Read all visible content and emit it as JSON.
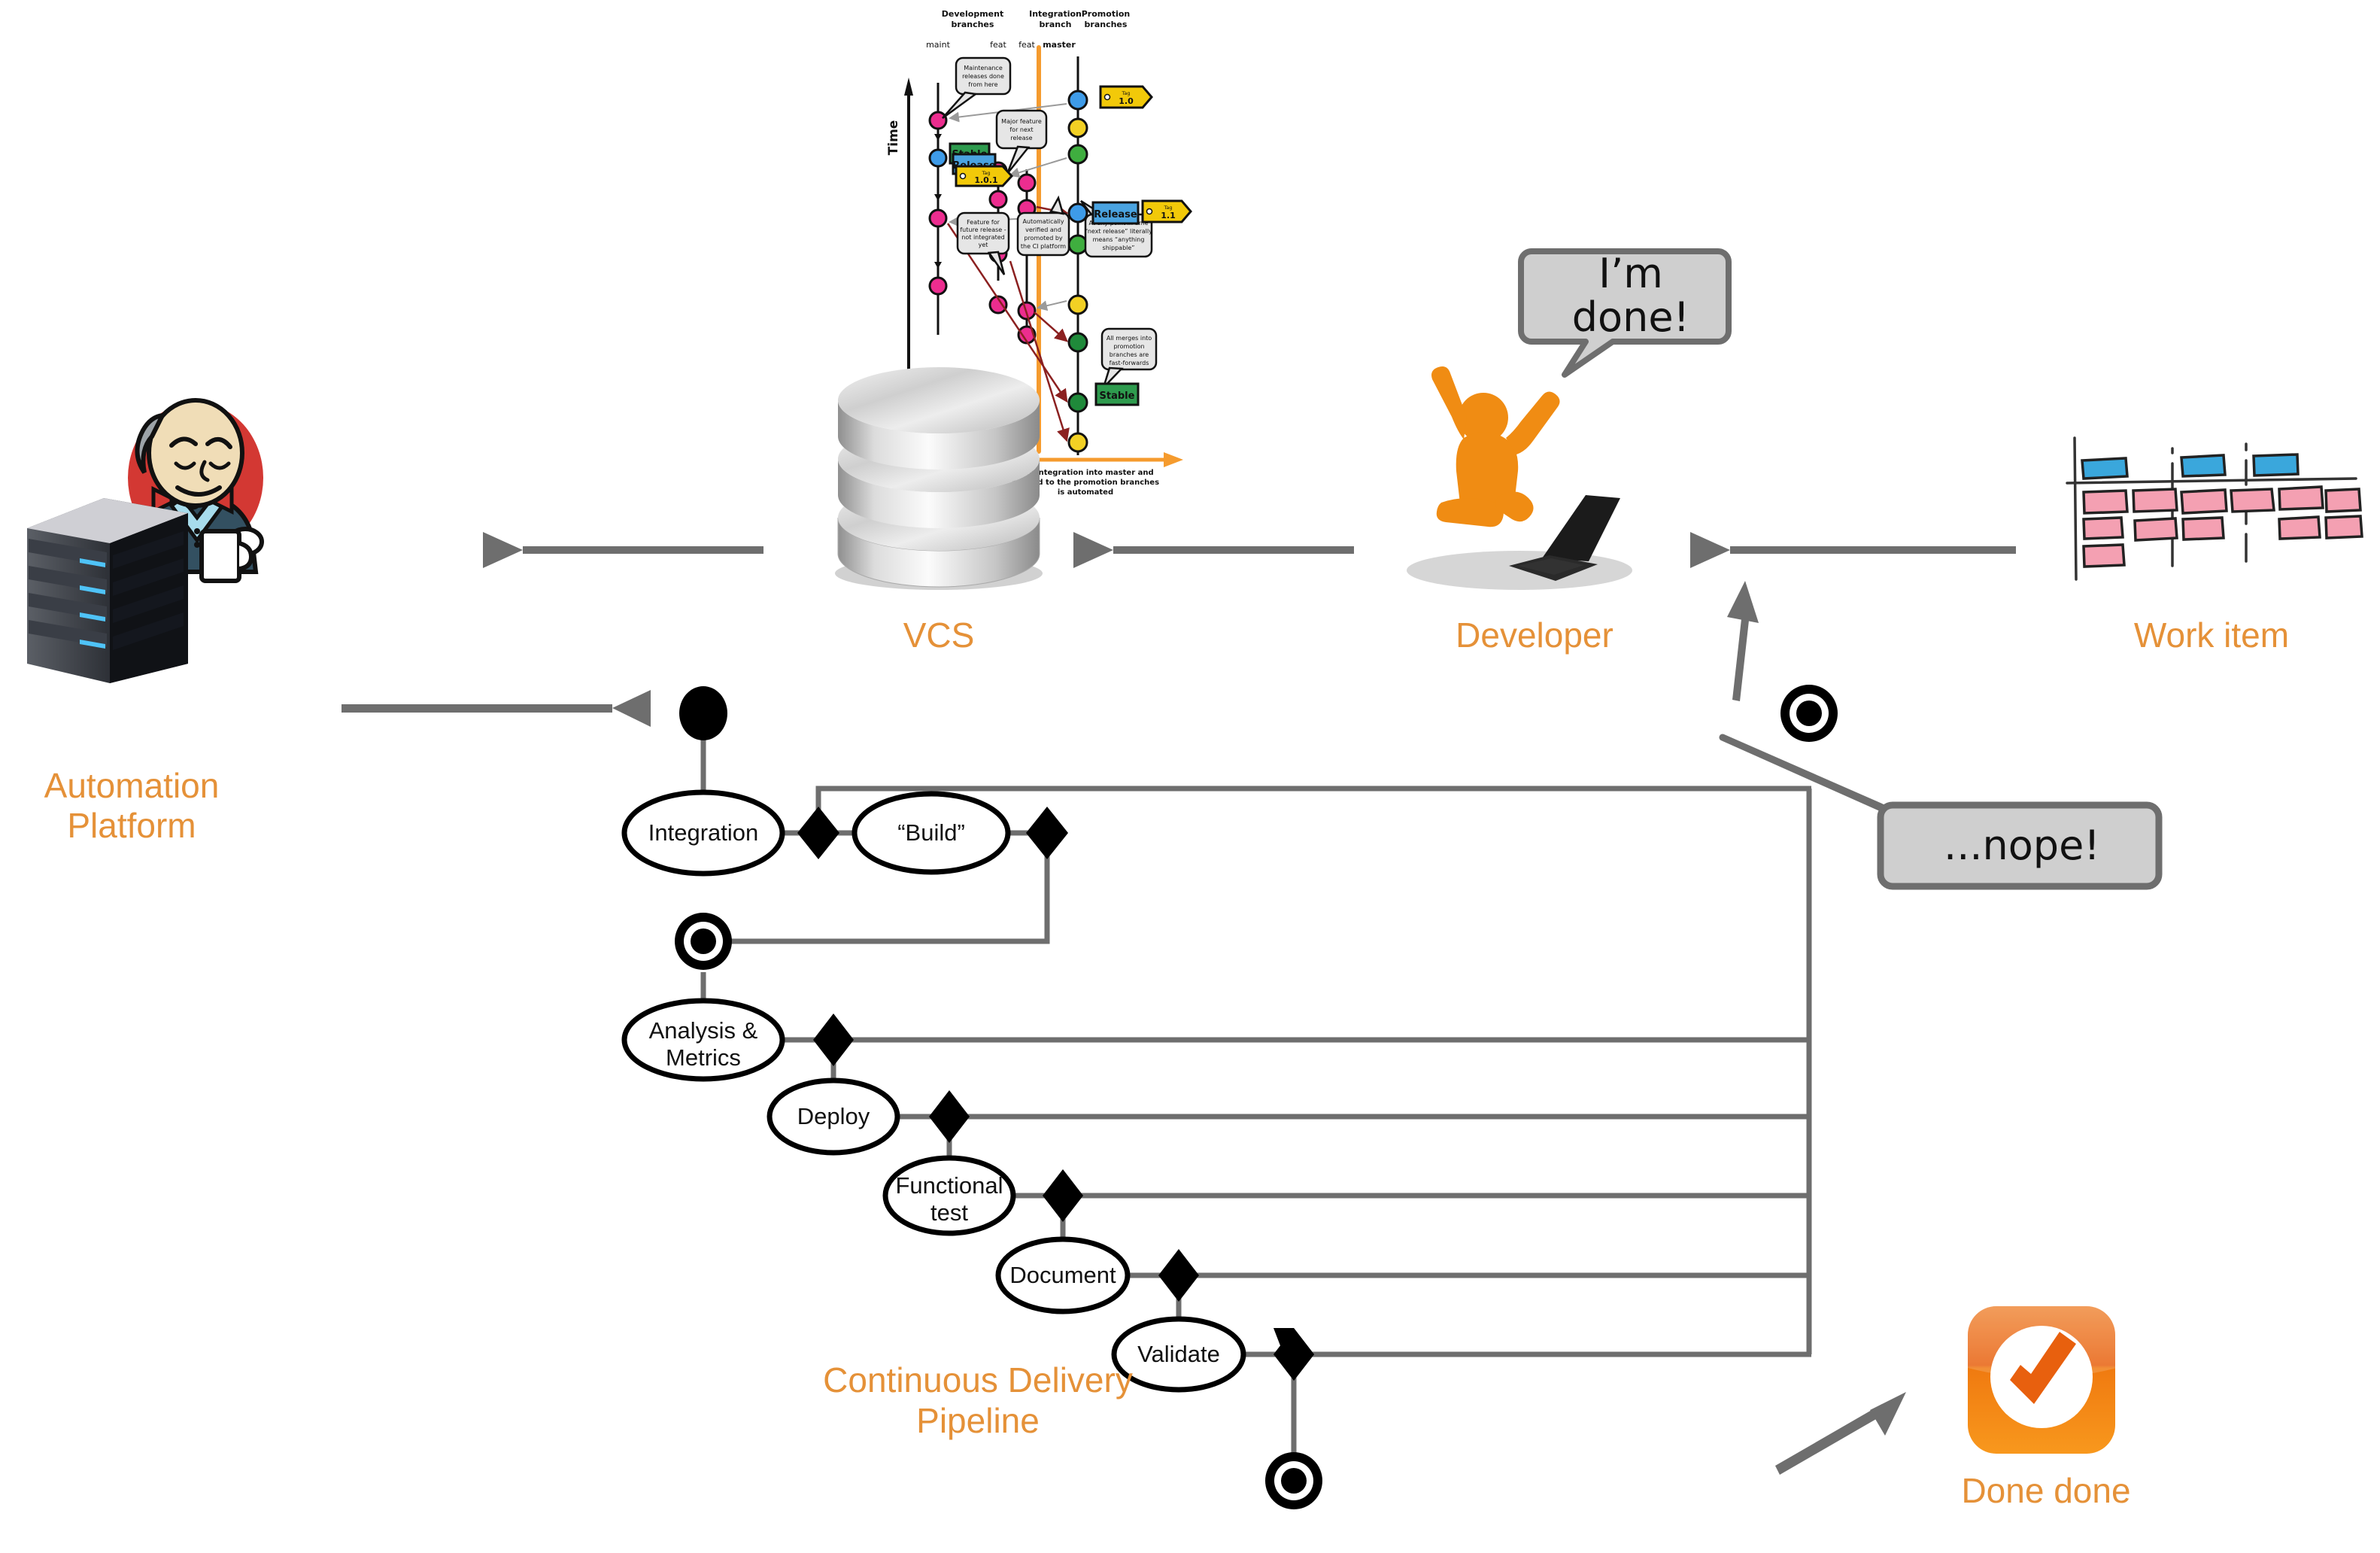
{
  "diagram": {
    "title": "Continuous Delivery Pipeline",
    "accent_color": "#E59138",
    "line_color": "#6E6E6E",
    "node_color": "#000000"
  },
  "actors": {
    "automation_platform": {
      "label": "Automation\nPlatform",
      "icon": "jenkins-server-icon"
    },
    "vcs": {
      "label": "VCS",
      "icon": "database-cylinder-icon"
    },
    "developer": {
      "label": "Developer",
      "icon": "developer-figure-icon"
    },
    "work_item": {
      "label": "Work item",
      "icon": "kanban-board-icon"
    },
    "done_done": {
      "label": "Done done",
      "icon": "orange-checkmark-icon"
    }
  },
  "speech_bubbles": [
    {
      "name": "developer-done-bubble",
      "text": "I’m\ndone!"
    },
    {
      "name": "nope-bubble",
      "text": "...nope!"
    }
  ],
  "pipeline": {
    "caption": "Continuous Delivery Pipeline",
    "stages": [
      {
        "label": "Integration"
      },
      {
        "label": "“Build”"
      },
      {
        "label": "Analysis &\nMetrics"
      },
      {
        "label": "Deploy"
      },
      {
        "label": "Functional\ntest"
      },
      {
        "label": "Document"
      },
      {
        "label": "Validate"
      }
    ],
    "start_node": "initial-node",
    "end_nodes": [
      "build-fail-end-node",
      "reject-end-node",
      "success-end-node"
    ],
    "decision_count": 7
  },
  "branching_diagram": {
    "axis_label": "Time",
    "column_headers": [
      {
        "text": "Development\nbranches",
        "color": "#2E6FAE"
      },
      {
        "text": "Integration\nbranch",
        "color": "#111111"
      },
      {
        "text": "Promotion\nbranches",
        "color": "#E8842B"
      }
    ],
    "branch_names": [
      "maint",
      "feat",
      "feat",
      "master"
    ],
    "callouts": [
      "Maintenance\nreleases done\nfrom here",
      "Major feature\nfor next\nrelease",
      "Feature for\nfuture release -\nnot integrated\nyet",
      "Automatically\nverified and\npromoted by\nthe CI platform",
      "At any point in time\n“next release” literally\nmeans “anything\nshippable”",
      "All merges into\npromotion\nbranches are\nfast-forwards"
    ],
    "tags": [
      {
        "kind": "Tag",
        "version": "1.0"
      },
      {
        "kind": "Tag",
        "version": "1.0.1"
      },
      {
        "kind": "Tag",
        "version": "1.1"
      }
    ],
    "badges": [
      {
        "text": "Stable",
        "color": "#2E9B4E"
      },
      {
        "text": "Release",
        "color": "#4AA3E0"
      },
      {
        "text": "Stable",
        "color": "#2E9B4E"
      },
      {
        "text": "Release",
        "color": "#4AA3E0"
      }
    ],
    "footer_note": "Any integration into master and\nbeyond to the promotion branches\nis automated"
  }
}
